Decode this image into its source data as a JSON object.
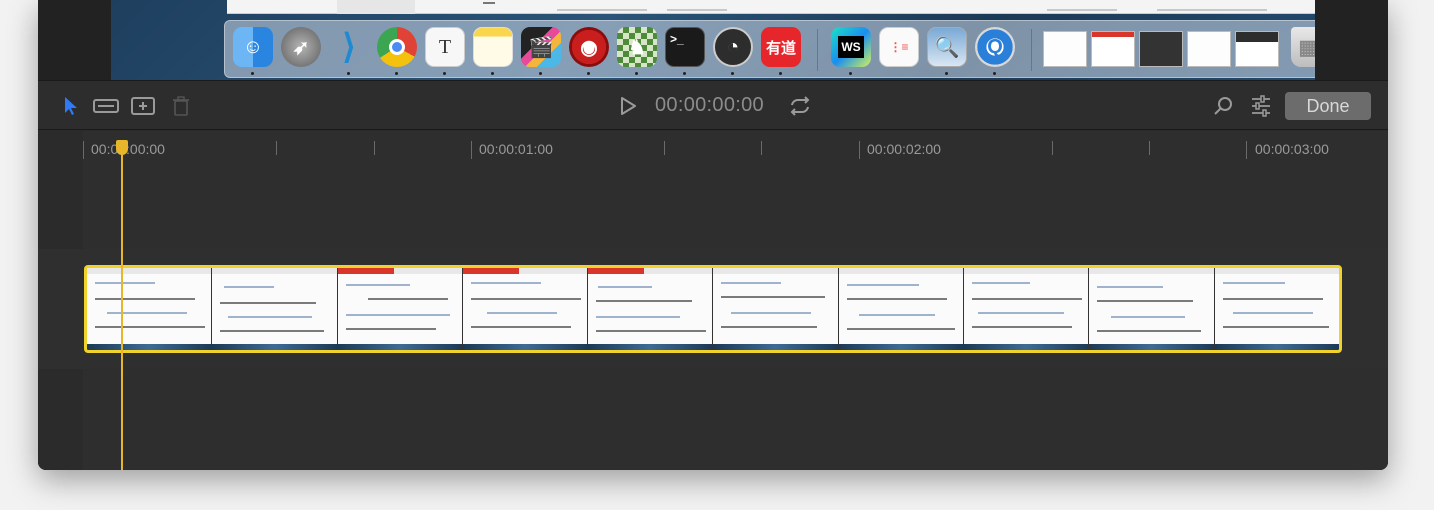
{
  "toolbar": {
    "timecode": "00:00:00:00",
    "done_label": "Done",
    "tools": [
      {
        "name": "select-arrow-icon"
      },
      {
        "name": "trim-icon"
      },
      {
        "name": "add-frame-icon"
      },
      {
        "name": "trash-icon"
      }
    ],
    "play_icon": "play-icon",
    "loop_icon": "loop-icon",
    "search_icon": "search-icon",
    "settings_icon": "sliders-icon"
  },
  "dock": {
    "icons": [
      "finder",
      "launchpad",
      "vscode",
      "chrome",
      "typora",
      "notes",
      "final-cut",
      "eye-app",
      "chess",
      "terminal",
      "obs",
      "youdao",
      "webstorm",
      "reminders",
      "preview",
      "quicktime"
    ],
    "youdao_label": "有道",
    "ws_label": "WS",
    "terminal_label": ">_"
  },
  "ruler": {
    "labels": [
      "00:00:00:00",
      "00:00:01:00",
      "00:00:02:00",
      "00:00:03:00"
    ]
  },
  "colors": {
    "accent": "#f0d22a",
    "playhead": "#e7b62b",
    "select_tool": "#2f7bf6"
  }
}
